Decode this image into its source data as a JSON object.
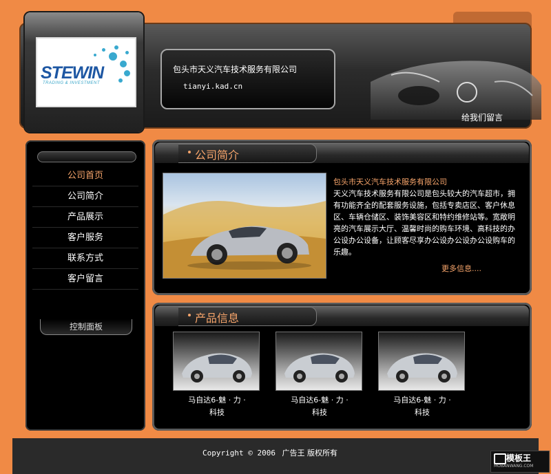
{
  "header": {
    "company_name": "包头市天义汽车技术服务有限公司",
    "domain": "tianyi.kad.cn",
    "guestbook_link": "给我们留言",
    "logo": {
      "brand": "STEWIN",
      "tagline": "TRADING & INVESTMENT"
    }
  },
  "sidebar": {
    "items": [
      {
        "label": "公司首页",
        "active": true
      },
      {
        "label": "公司简介",
        "active": false
      },
      {
        "label": "产品展示",
        "active": false
      },
      {
        "label": "客户服务",
        "active": false
      },
      {
        "label": "联系方式",
        "active": false
      },
      {
        "label": "客户留言",
        "active": false
      }
    ],
    "control_panel": "控制面板"
  },
  "intro": {
    "title": "公司简介",
    "heading": "包头市天义汽车技术服务有限公司",
    "body": "天义汽车技术服务有限公司是包头较大的汽车超市，拥有功能齐全的配套服务设施，包括专卖店区、客户休息区、车辆仓储区、装饰美容区和特约维修站等。宽敞明亮的汽车展示大厅、温馨时尚的购车环境、高科技的办公设办公设备，让顾客尽享办公设办公设办公设购车的乐趣。",
    "more": "更多信息...."
  },
  "products": {
    "title": "产品信息",
    "items": [
      {
        "line1": "马自达6-魅 · 力 ·",
        "line2": "科技"
      },
      {
        "line1": "马自达6-魅 · 力 ·",
        "line2": "科技"
      },
      {
        "line1": "马自达6-魅 · 力 ·",
        "line2": "科技"
      }
    ]
  },
  "footer": {
    "copyright_prefix": "Copyright © 2006",
    "copyright_suffix": "广告王  版权所有"
  },
  "watermark": {
    "main": "模板王",
    "sub": "MOBANWANG.COM"
  },
  "colors": {
    "page_bg": "#f08a45",
    "accent": "#f7a56b",
    "panel_bg": "#000000"
  }
}
